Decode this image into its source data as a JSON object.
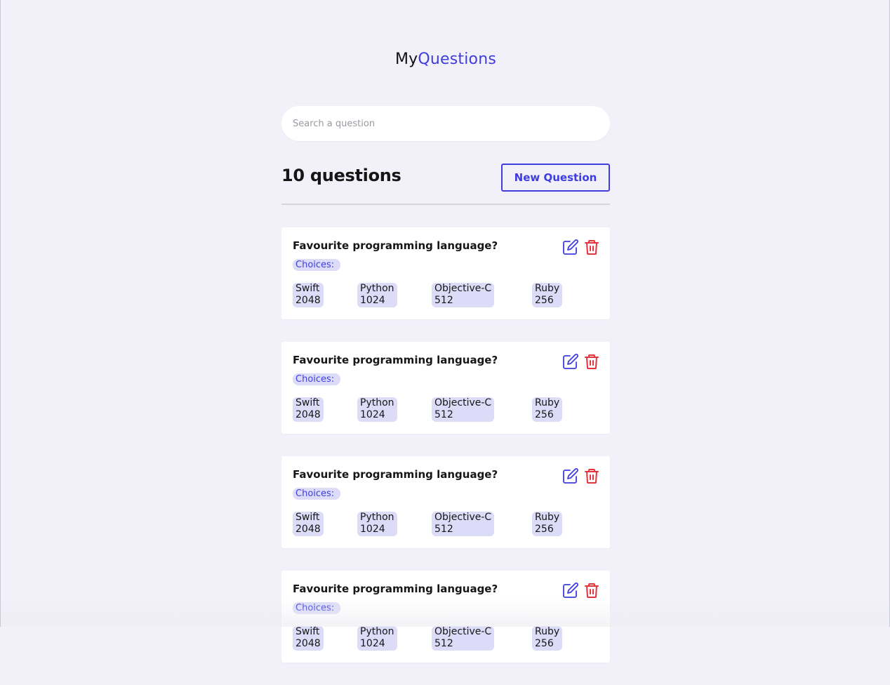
{
  "header": {
    "logo_my": "My",
    "logo_questions": "Questions"
  },
  "search": {
    "placeholder": "Search a question",
    "value": ""
  },
  "toolbar": {
    "count_label": "10 questions",
    "new_button_label": "New Question"
  },
  "colors": {
    "accent": "#3d3de0",
    "danger": "#e5323b",
    "background": "#f2f1fa",
    "chip": "#dcdcf8"
  },
  "icons": {
    "edit": "edit-icon",
    "delete": "trash-icon"
  },
  "questions": [
    {
      "title": "Favourite programming language?",
      "choices_label": "Choices:",
      "choices": [
        {
          "name": "Swift",
          "votes": "2048"
        },
        {
          "name": "Python",
          "votes": "1024"
        },
        {
          "name": "Objective-C",
          "votes": "512"
        },
        {
          "name": "Ruby",
          "votes": "256"
        }
      ]
    },
    {
      "title": "Favourite programming language?",
      "choices_label": "Choices:",
      "choices": [
        {
          "name": "Swift",
          "votes": "2048"
        },
        {
          "name": "Python",
          "votes": "1024"
        },
        {
          "name": "Objective-C",
          "votes": "512"
        },
        {
          "name": "Ruby",
          "votes": "256"
        }
      ]
    },
    {
      "title": "Favourite programming language?",
      "choices_label": "Choices:",
      "choices": [
        {
          "name": "Swift",
          "votes": "2048"
        },
        {
          "name": "Python",
          "votes": "1024"
        },
        {
          "name": "Objective-C",
          "votes": "512"
        },
        {
          "name": "Ruby",
          "votes": "256"
        }
      ]
    },
    {
      "title": "Favourite programming language?",
      "choices_label": "Choices:",
      "choices": [
        {
          "name": "Swift",
          "votes": "2048"
        },
        {
          "name": "Python",
          "votes": "1024"
        },
        {
          "name": "Objective-C",
          "votes": "512"
        },
        {
          "name": "Ruby",
          "votes": "256"
        }
      ]
    }
  ]
}
